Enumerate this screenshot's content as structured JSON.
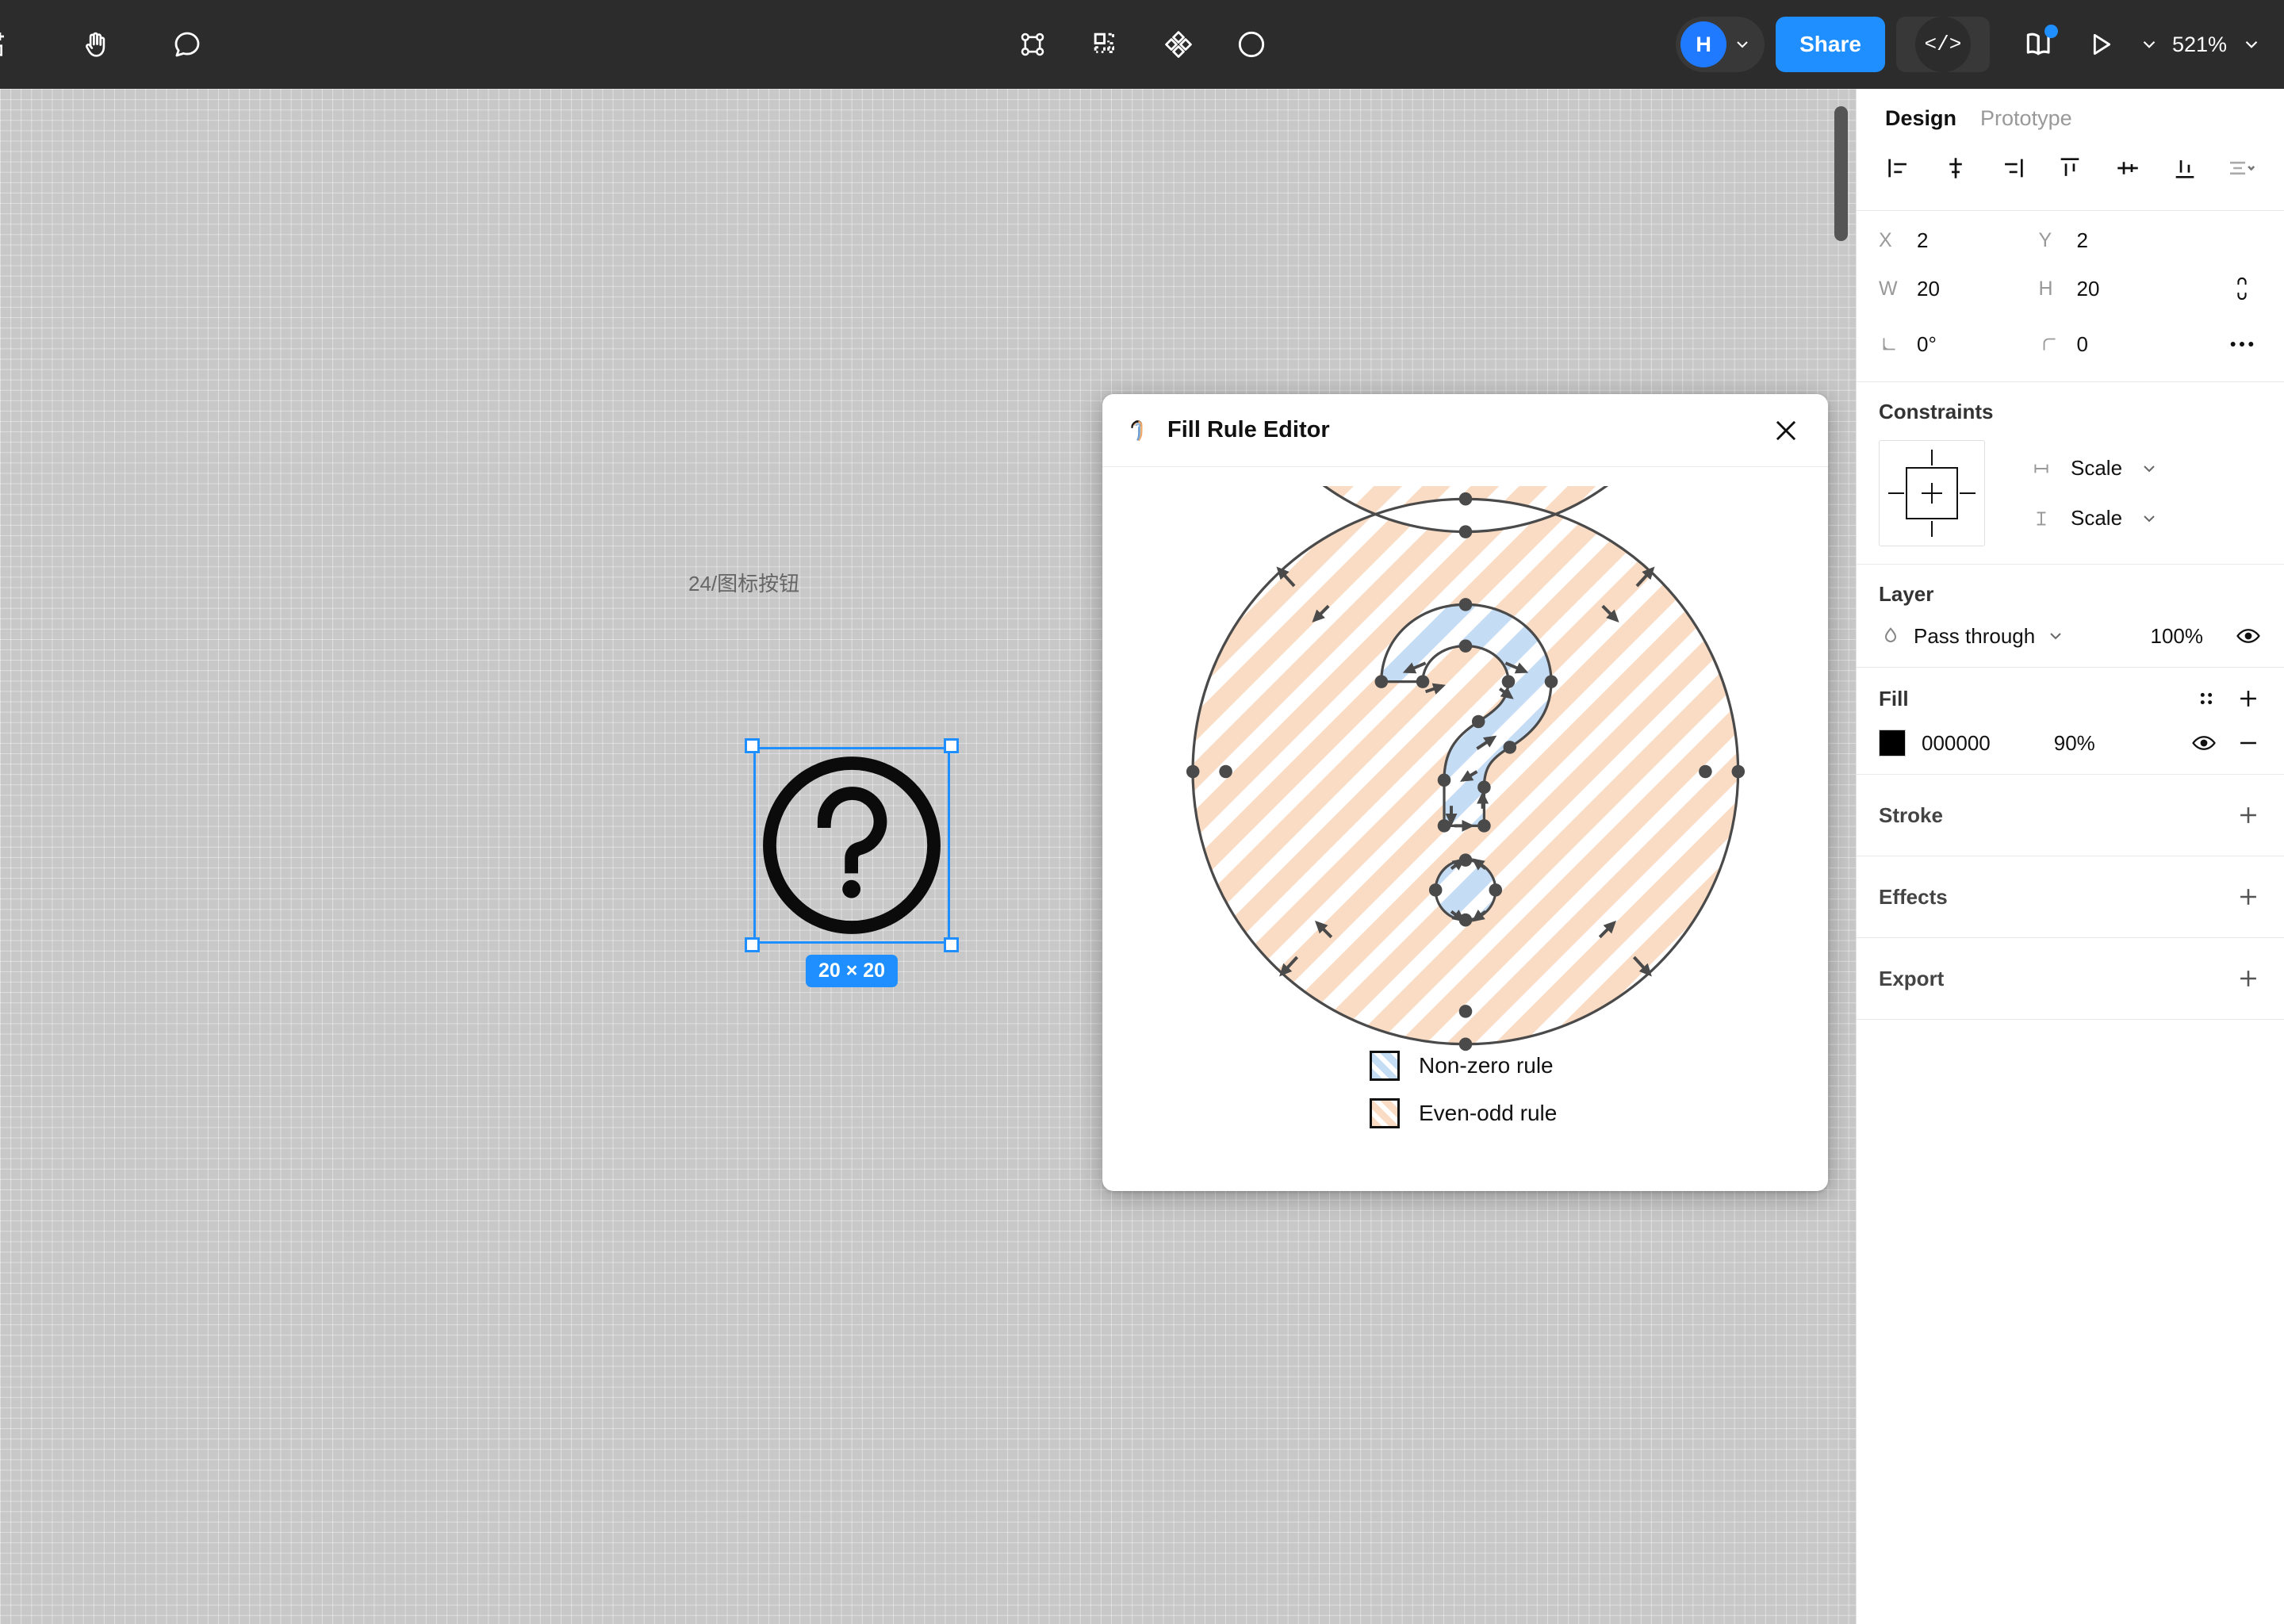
{
  "toolbar": {
    "left_tools": [
      {
        "name": "frame-tool-icon",
        "label": "Frame"
      },
      {
        "name": "hand-tool-icon",
        "label": "Hand tool"
      },
      {
        "name": "comment-tool-icon",
        "label": "Comment"
      }
    ],
    "center_tools": [
      {
        "name": "vector-points-plugin-icon",
        "label": "Vector points"
      },
      {
        "name": "grid-layout-plugin-icon",
        "label": "Grid layout"
      },
      {
        "name": "diamond-pattern-plugin-icon",
        "label": "Pattern"
      },
      {
        "name": "contrast-plugin-icon",
        "label": "Contrast"
      }
    ],
    "avatar_initial": "H",
    "share_label": "Share",
    "code_label": "</>",
    "library_icon": "book-library-icon",
    "present_icon": "play-present-icon",
    "zoom_level": "521%"
  },
  "canvas": {
    "frame_label": "24/图标按钮",
    "selection_size": "20 × 20"
  },
  "dialog": {
    "title": "Fill Rule Editor",
    "plugin_icon": "fill-rule-plugin-icon",
    "close_icon": "close-icon",
    "legend": [
      {
        "label": "Non-zero rule",
        "color": "#c5dcf5",
        "swatch": "blue-striped"
      },
      {
        "label": "Even-odd rule",
        "color": "#fadcc4",
        "swatch": "orange-striped"
      }
    ]
  },
  "panel": {
    "tabs": [
      {
        "label": "Design",
        "active": true
      },
      {
        "label": "Prototype",
        "active": false
      }
    ],
    "align_buttons": [
      {
        "name": "align-left-icon",
        "label": "Align left"
      },
      {
        "name": "align-horizontal-center-icon",
        "label": "Align horizontal centers"
      },
      {
        "name": "align-right-icon",
        "label": "Align right"
      },
      {
        "name": "align-top-icon",
        "label": "Align top"
      },
      {
        "name": "align-vertical-center-icon",
        "label": "Align vertical centers"
      },
      {
        "name": "align-bottom-icon",
        "label": "Align bottom"
      },
      {
        "name": "distribute-menu-icon",
        "label": "Tidy up"
      }
    ],
    "position": {
      "x_label": "X",
      "x_value": "2",
      "y_label": "Y",
      "y_value": "2",
      "w_label": "W",
      "w_value": "20",
      "h_label": "H",
      "h_value": "20",
      "rotation_label": "rotation",
      "rotation_value": "0°",
      "corner_label": "corner-radius",
      "corner_value": "0",
      "lock_icon": "proportion-lock-icon",
      "more_icon": "more-options-icon"
    },
    "constraints": {
      "title": "Constraints",
      "horizontal_value": "Scale",
      "vertical_value": "Scale"
    },
    "layer": {
      "title": "Layer",
      "blend_mode": "Pass through",
      "opacity": "100%",
      "visible_icon": "eye-icon"
    },
    "fill": {
      "title": "Fill",
      "hex": "000000",
      "opacity": "90%",
      "swatch_color": "#000000",
      "styles_icon": "fill-styles-icon",
      "add_icon": "plus-icon",
      "visible_icon": "eye-icon",
      "remove_icon": "minus-icon"
    },
    "collapsed_sections": [
      {
        "title": "Stroke",
        "add_icon": "plus-icon"
      },
      {
        "title": "Effects",
        "add_icon": "plus-icon"
      },
      {
        "title": "Export",
        "add_icon": "plus-icon"
      }
    ]
  }
}
